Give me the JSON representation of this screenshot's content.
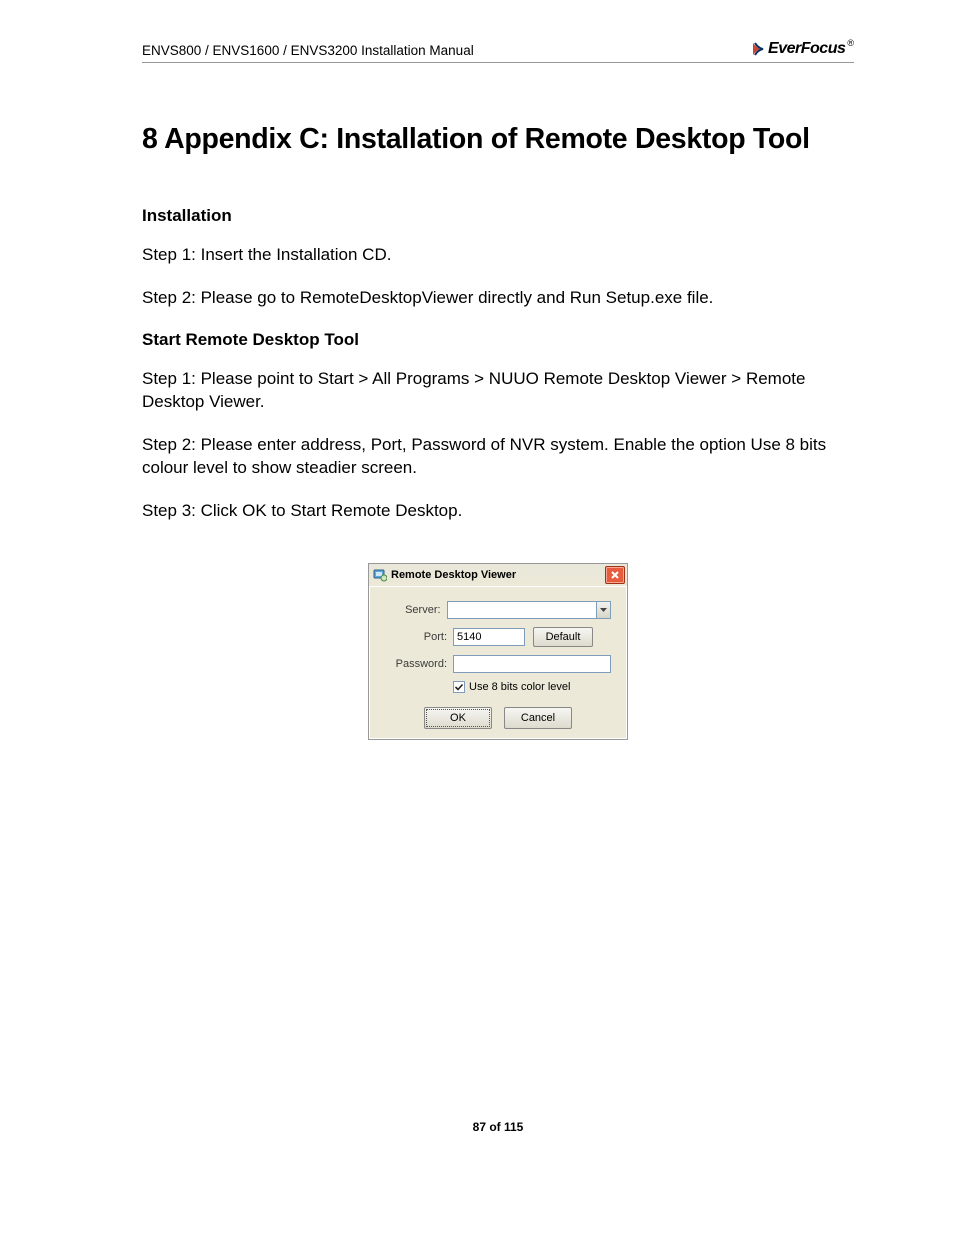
{
  "header": {
    "doc_title": "ENVS800 / ENVS1600 / ENVS3200 Installation Manual",
    "brand_name": "EverFocus",
    "brand_reg": "®"
  },
  "content": {
    "heading": "8  Appendix C: Installation of Remote Desktop Tool",
    "section_install": "Installation",
    "step1a": "Step 1: Insert the Installation CD.",
    "step2a": "Step 2: Please go to RemoteDesktopViewer directly and Run Setup.exe file.",
    "section_start": "Start Remote Desktop Tool",
    "step1b": "Step 1: Please point to Start > All Programs > NUUO Remote Desktop Viewer > Remote Desktop Viewer.",
    "step2b": "Step 2: Please enter address, Port, Password of NVR system. Enable the option Use 8 bits colour level to show steadier screen.",
    "step3b": "Step 3: Click OK to Start Remote Desktop."
  },
  "dialog": {
    "title": "Remote Desktop Viewer",
    "server_label": "Server:",
    "server_value": "",
    "port_label": "Port:",
    "port_value": "5140",
    "default_btn": "Default",
    "password_label": "Password:",
    "password_value": "",
    "checkbox_label": "Use 8 bits color level",
    "ok_btn": "OK",
    "cancel_btn": "Cancel"
  },
  "footer": {
    "page_of": "87 of 115"
  }
}
